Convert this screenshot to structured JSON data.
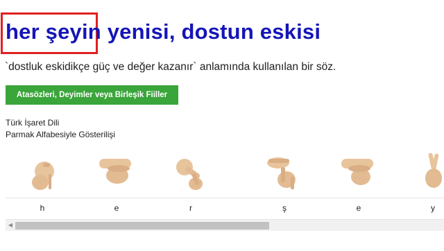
{
  "title": {
    "text": "her şeyin yenisi, dostun eskisi",
    "highlighted_phrase": "her şeyin"
  },
  "meaning": "`dostluk eskidikçe güç ve değer kazanır` anlamında kullanılan bir söz.",
  "category_button": {
    "label": "Atasözleri, Deyimler veya Birleşik Fiiller",
    "color": "#3aa53a"
  },
  "sign_language": {
    "line1": "Türk İşaret Dili",
    "line2": "Parmak Alfabesiyle Gösterilişi"
  },
  "signs": [
    {
      "letter": "h",
      "icon": "hand-sign-h-icon"
    },
    {
      "letter": "e",
      "icon": "hand-sign-e-icon"
    },
    {
      "letter": "r",
      "icon": "hand-sign-r-icon"
    },
    {
      "letter": "ş",
      "icon": "hand-sign-s-cedilla-icon"
    },
    {
      "letter": "e",
      "icon": "hand-sign-e-icon"
    },
    {
      "letter": "y",
      "icon": "hand-sign-y-icon"
    }
  ],
  "colors": {
    "title": "#1515b8",
    "highlight_box": "#e02020",
    "skin": "#e8c49c"
  }
}
